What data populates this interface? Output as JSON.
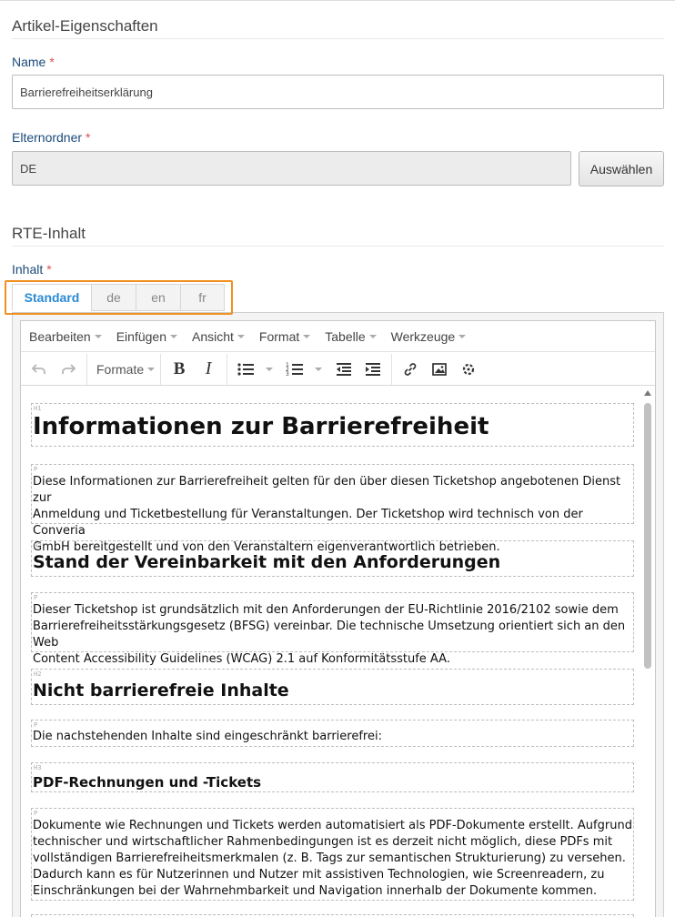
{
  "sections": {
    "article_properties": "Artikel-Eigenschaften",
    "rte_content": "RTE-Inhalt"
  },
  "fields": {
    "name": {
      "label": "Name",
      "required_mark": "*",
      "value": "Barrierefreiheitserklärung"
    },
    "parent_folder": {
      "label": "Elternordner",
      "required_mark": "*",
      "value": "DE",
      "button": "Auswählen"
    },
    "content": {
      "label": "Inhalt",
      "required_mark": "*"
    }
  },
  "tabs": [
    "Standard",
    "de",
    "en",
    "fr"
  ],
  "active_tab": "Standard",
  "editor": {
    "menu": [
      "Bearbeiten",
      "Einfügen",
      "Ansicht",
      "Format",
      "Tabelle",
      "Werkzeuge"
    ],
    "toolbar": {
      "formats_label": "Formate",
      "icons": [
        "undo-icon",
        "redo-icon",
        "bold-icon",
        "italic-icon",
        "bullet-list-icon",
        "numbered-list-icon",
        "outdent-icon",
        "indent-icon",
        "link-icon",
        "image-icon",
        "spellcheck-icon"
      ]
    },
    "blocks": [
      {
        "tag": "H1",
        "text": "Informationen zur Barrierefreiheit"
      },
      {
        "tag": "P",
        "lines": [
          "Diese Informationen zur Barrierefreiheit gelten für den über diesen Ticketshop angebotenen Dienst zur",
          "Anmeldung und Ticketbestellung für Veranstaltungen. Der Ticketshop wird technisch von der Converia",
          "GmbH bereitgestellt und von den Veranstaltern eigenverantwortlich betrieben."
        ]
      },
      {
        "tag": "H2",
        "text": "Stand der Vereinbarkeit mit den Anforderungen"
      },
      {
        "tag": "P",
        "lines": [
          "Dieser Ticketshop ist grundsätzlich mit den Anforderungen der EU-Richtlinie 2016/2102 sowie dem",
          "Barrierefreiheitsstärkungsgesetz (BFSG) vereinbar. Die technische Umsetzung orientiert sich an den Web",
          "Content Accessibility Guidelines (WCAG) 2.1 auf Konformitätsstufe AA."
        ]
      },
      {
        "tag": "H2",
        "text": "Nicht barrierefreie Inhalte"
      },
      {
        "tag": "P",
        "lines": [
          "Die nachstehenden Inhalte sind eingeschränkt barrierefrei:"
        ]
      },
      {
        "tag": "H3",
        "text": "PDF-Rechnungen und -Tickets"
      },
      {
        "tag": "P",
        "lines": [
          "Dokumente wie Rechnungen und Tickets werden automatisiert als PDF-Dokumente erstellt. Aufgrund",
          "technischer und wirtschaftlicher Rahmenbedingungen ist es derzeit nicht möglich, diese PDFs mit",
          "vollständigen Barrierefreiheitsmerkmalen (z. B. Tags zur semantischen Strukturierung) zu versehen.",
          "Dadurch kann es für Nutzerinnen und Nutzer mit assistiven Technologien, wie Screenreadern, zu",
          "Einschränkungen bei der Wahrnehmbarkeit und Navigation innerhalb der Dokumente kommen."
        ]
      }
    ]
  }
}
